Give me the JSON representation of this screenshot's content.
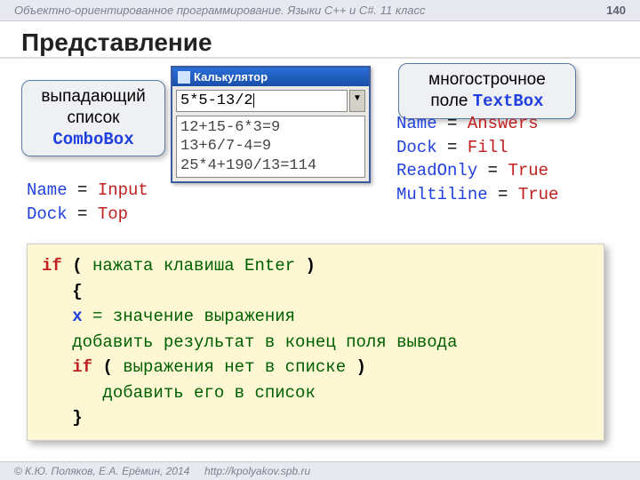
{
  "header": {
    "course": "Объектно-ориентированное программирование. Языки C++ и C#. 11 класс",
    "page": "140"
  },
  "title": "Представление",
  "callout_left": {
    "line1": "выпадающий",
    "line2": "список",
    "kw": "ComboBox"
  },
  "callout_right": {
    "line1": "многострочное",
    "line2_a": "поле ",
    "kw": "TextBox"
  },
  "window": {
    "title": "Калькулятор",
    "input": "5*5-13/2",
    "out1": "12+15-6*3=9",
    "out2": "13+6/7-4=9",
    "out3": "25*4+190/13=114"
  },
  "props_left": {
    "l1_n": "Name",
    "l1_v": "Input",
    "l2_n": "Dock",
    "l2_v": "Top"
  },
  "props_right": {
    "l1_n": "Name",
    "l1_v": "Answers",
    "l2_n": "Dock",
    "l2_v": "Fill",
    "l3_n": "ReadOnly",
    "l3_v": "True",
    "l4_n": "Multiline",
    "l4_v": "True"
  },
  "code": {
    "l1_kw": "if",
    "l1_txt": "нажата клавиша Enter",
    "l2": "{",
    "l3_var": "x",
    "l3_txt": "значение выражения",
    "l4": "добавить результат в конец поля вывода",
    "l5_kw": "if",
    "l5_txt": "выражения нет в списке",
    "l6": "добавить его в список",
    "l7": "}"
  },
  "footer": {
    "copy": "© К.Ю. Поляков, Е.А. Ерёмин, 2014",
    "url": "http://kpolyakov.spb.ru"
  }
}
